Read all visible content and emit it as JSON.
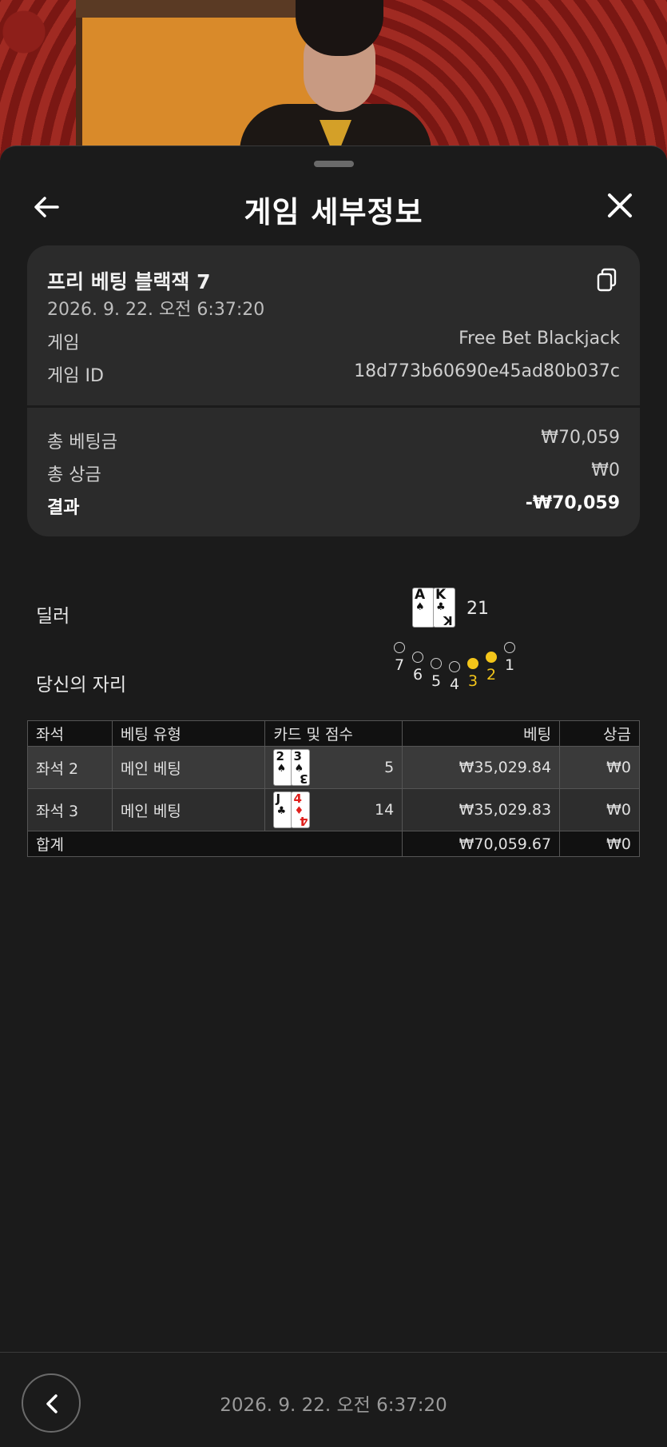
{
  "header": {
    "title": "게임 세부정보"
  },
  "summary": {
    "game_name": "프리 베팅 블랙잭 7",
    "datetime": "2026. 9. 22. 오전 6:37:20",
    "game_label": "게임",
    "game_value": "Free Bet Blackjack",
    "game_id_label": "게임 ID",
    "game_id_value": "18d773b60690e45ad80b037c",
    "total_bet_label": "총 베팅금",
    "total_bet_value": "₩70,059",
    "total_win_label": "총 상금",
    "total_win_value": "₩0",
    "result_label": "결과",
    "result_value": "-₩70,059"
  },
  "dealer": {
    "label": "딜러",
    "score": "21",
    "cards": [
      {
        "rank": "A",
        "suit": "♠",
        "color": "black"
      },
      {
        "rank": "K",
        "suit": "♣",
        "color": "black"
      }
    ]
  },
  "seats": {
    "label": "당신의 자리",
    "items": [
      {
        "num": "7",
        "active": false
      },
      {
        "num": "6",
        "active": false
      },
      {
        "num": "5",
        "active": false
      },
      {
        "num": "4",
        "active": false
      },
      {
        "num": "3",
        "active": true
      },
      {
        "num": "2",
        "active": true
      },
      {
        "num": "1",
        "active": false
      }
    ]
  },
  "table": {
    "headers": [
      "좌석",
      "베팅 유형",
      "카드 및 점수",
      "베팅",
      "상금"
    ],
    "rows": [
      {
        "seat": "좌석 2",
        "type": "메인 베팅",
        "cards": [
          {
            "rank": "2",
            "suit": "♠",
            "color": "black"
          },
          {
            "rank": "3",
            "suit": "♠",
            "color": "black"
          }
        ],
        "score": "5",
        "bet": "₩35,029.84",
        "win": "₩0"
      },
      {
        "seat": "좌석 3",
        "type": "메인 베팅",
        "cards": [
          {
            "rank": "J",
            "suit": "♣",
            "color": "black"
          },
          {
            "rank": "4",
            "suit": "♦",
            "color": "red"
          }
        ],
        "score": "14",
        "bet": "₩35,029.83",
        "win": "₩0"
      }
    ],
    "total_label": "합계",
    "total_bet": "₩70,059.67",
    "total_win": "₩0"
  },
  "footer": {
    "datetime": "2026. 9. 22. 오전 6:37:20"
  },
  "colors": {
    "sheet_bg": "#1b1b1b",
    "card_bg": "#2b2b2b",
    "active_seat": "#f3c51a"
  },
  "icons": {
    "back": "arrow-left-icon",
    "close": "close-icon",
    "copy": "copy-icon",
    "footer_back": "chevron-left-icon"
  }
}
